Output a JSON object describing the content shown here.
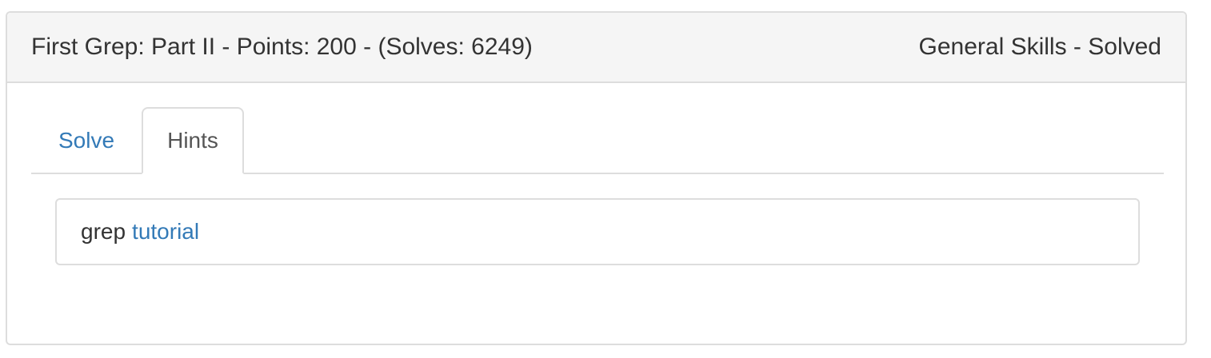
{
  "challenge": {
    "title": "First Grep: Part II",
    "points": "200",
    "solves": "6249",
    "heading_left": "First Grep: Part II - Points: 200 - (Solves: 6249)",
    "heading_right": "General Skills - Solved",
    "category": "General Skills",
    "status": "Solved"
  },
  "tabs": [
    {
      "label": "Solve",
      "active": false
    },
    {
      "label": "Hints",
      "active": true
    }
  ],
  "hint": {
    "text": "grep",
    "link_text": "tutorial"
  },
  "colors": {
    "link": "#337ab7",
    "heading_bg": "#f5f5f5",
    "border": "#dddddd",
    "text": "#333333"
  }
}
